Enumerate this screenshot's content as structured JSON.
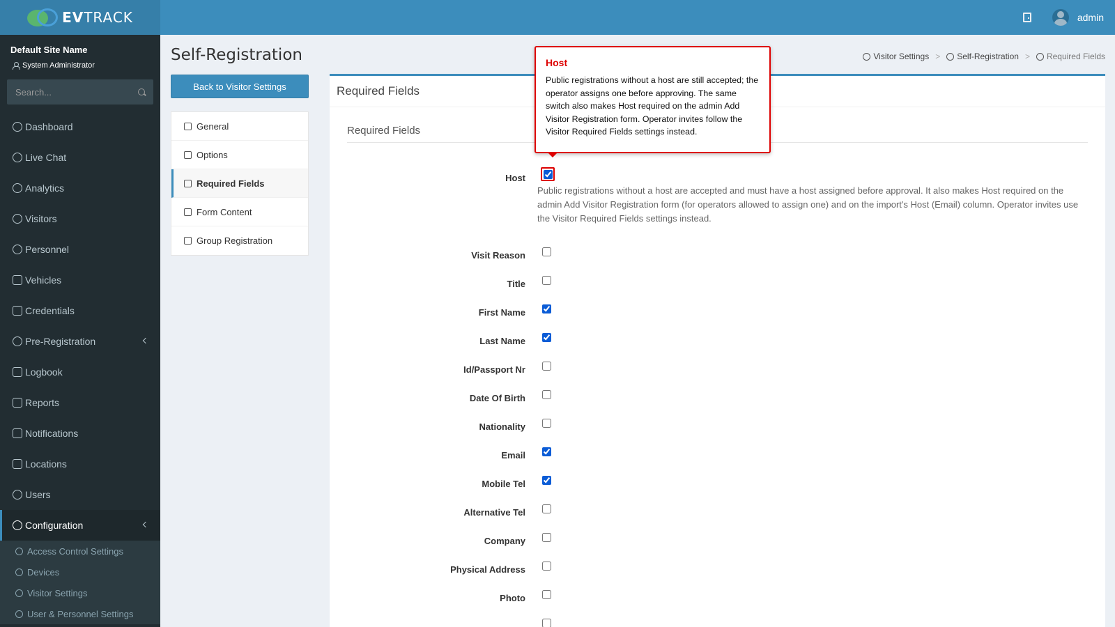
{
  "app": {
    "logo_prefix": "EV",
    "logo_suffix": "TRACK",
    "username": "admin"
  },
  "sidebar": {
    "site_name": "Default Site Name",
    "role": "System Administrator",
    "search_placeholder": "Search...",
    "items": [
      {
        "label": "Dashboard",
        "icon": "dashboard-icon"
      },
      {
        "label": "Live Chat",
        "icon": "headset-icon"
      },
      {
        "label": "Analytics",
        "icon": "analytics-icon"
      },
      {
        "label": "Visitors",
        "icon": "eye-icon"
      },
      {
        "label": "Personnel",
        "icon": "personnel-icon"
      },
      {
        "label": "Vehicles",
        "icon": "car-icon"
      },
      {
        "label": "Credentials",
        "icon": "id-card-icon"
      },
      {
        "label": "Pre-Registration",
        "icon": "arrows-icon"
      },
      {
        "label": "Logbook",
        "icon": "book-icon"
      },
      {
        "label": "Reports",
        "icon": "chart-icon"
      },
      {
        "label": "Notifications",
        "icon": "chat-icon"
      },
      {
        "label": "Locations",
        "icon": "map-icon"
      },
      {
        "label": "Users",
        "icon": "users-icon"
      },
      {
        "label": "Configuration",
        "icon": "gear-icon"
      }
    ],
    "sub_items": [
      {
        "label": "Access Control Settings",
        "icon": "lock-icon"
      },
      {
        "label": "Devices",
        "icon": "cog-icon"
      },
      {
        "label": "Visitor Settings",
        "icon": "eye-icon"
      },
      {
        "label": "User & Personnel Settings",
        "icon": "user-icon"
      }
    ]
  },
  "page": {
    "title": "Self-Registration",
    "back_label": "Back to Visitor Settings",
    "breadcrumb": [
      "Visitor Settings",
      "Self-Registration",
      "Required Fields"
    ],
    "breadcrumb_sep": ">"
  },
  "tabs": [
    {
      "label": "General",
      "icon": "sliders-icon"
    },
    {
      "label": "Options",
      "icon": "user-cog-icon"
    },
    {
      "label": "Required Fields",
      "icon": "checklist-icon"
    },
    {
      "label": "Form Content",
      "icon": "form-icon"
    },
    {
      "label": "Group Registration",
      "icon": "group-icon"
    }
  ],
  "box": {
    "header": "Required Fields",
    "section_title": "Required Fields",
    "host_help": "Public registrations without a host are accepted and must have a host assigned before approval. It also makes Host required on the admin Add Visitor Registration form (for operators allowed to assign one) and on the import's Host (Email) column. Operator invites use the Visitor Required Fields settings instead."
  },
  "fields": [
    {
      "label": "Host",
      "checked": true
    },
    {
      "label": "Visit Reason",
      "checked": false
    },
    {
      "label": "Title",
      "checked": false
    },
    {
      "label": "First Name",
      "checked": true
    },
    {
      "label": "Last Name",
      "checked": true
    },
    {
      "label": "Id/Passport Nr",
      "checked": false
    },
    {
      "label": "Date Of Birth",
      "checked": false
    },
    {
      "label": "Nationality",
      "checked": false
    },
    {
      "label": "Email",
      "checked": true
    },
    {
      "label": "Mobile Tel",
      "checked": true
    },
    {
      "label": "Alternative Tel",
      "checked": false
    },
    {
      "label": "Company",
      "checked": false
    },
    {
      "label": "Physical Address",
      "checked": false
    },
    {
      "label": "Photo",
      "checked": false
    }
  ],
  "tooltip": {
    "title": "Host",
    "body": "Public registrations without a host are still accepted; the operator assigns one before approving. The same switch also makes Host required on the admin Add Visitor Registration form. Operator invites follow the Visitor Required Fields settings instead."
  },
  "colors": {
    "topbar": "#3c8dbc",
    "sidebar": "#222d32",
    "accent": "#3c8dbc",
    "highlight": "#dd0000"
  }
}
